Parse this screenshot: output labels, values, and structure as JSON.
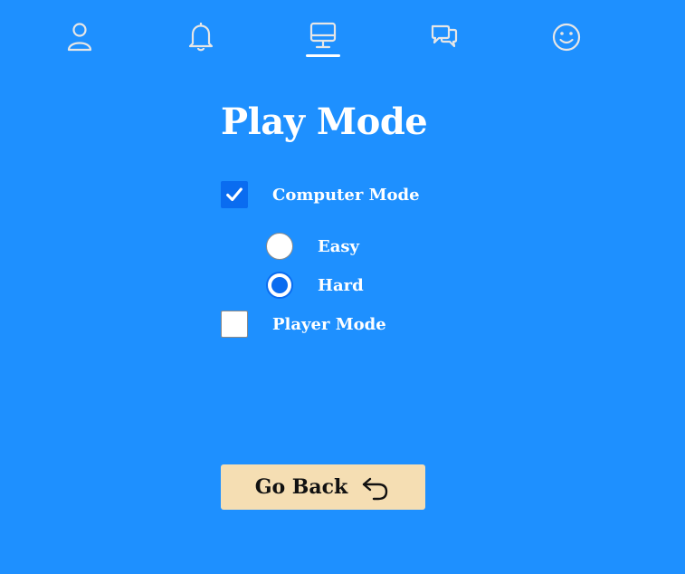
{
  "nav": {
    "items": [
      {
        "icon": "user-icon",
        "active": false
      },
      {
        "icon": "bell-icon",
        "active": false
      },
      {
        "icon": "monitor-icon",
        "active": true
      },
      {
        "icon": "chat-icon",
        "active": false
      },
      {
        "icon": "smiley-icon",
        "active": false
      }
    ]
  },
  "page": {
    "title": "Play Mode"
  },
  "options": {
    "computer_mode": {
      "label": "Computer Mode",
      "checked": true
    },
    "difficulty": {
      "selected": "Hard",
      "easy": {
        "label": "Easy",
        "selected": false
      },
      "hard": {
        "label": "Hard",
        "selected": true
      }
    },
    "player_mode": {
      "label": "Player Mode",
      "checked": false
    }
  },
  "back_button": {
    "label": "Go Back",
    "icon": "undo-arrow-icon"
  },
  "colors": {
    "background": "#1e90ff",
    "accent": "#0a6cf0",
    "button_bg": "#f5deb3",
    "text": "#ffffff"
  }
}
